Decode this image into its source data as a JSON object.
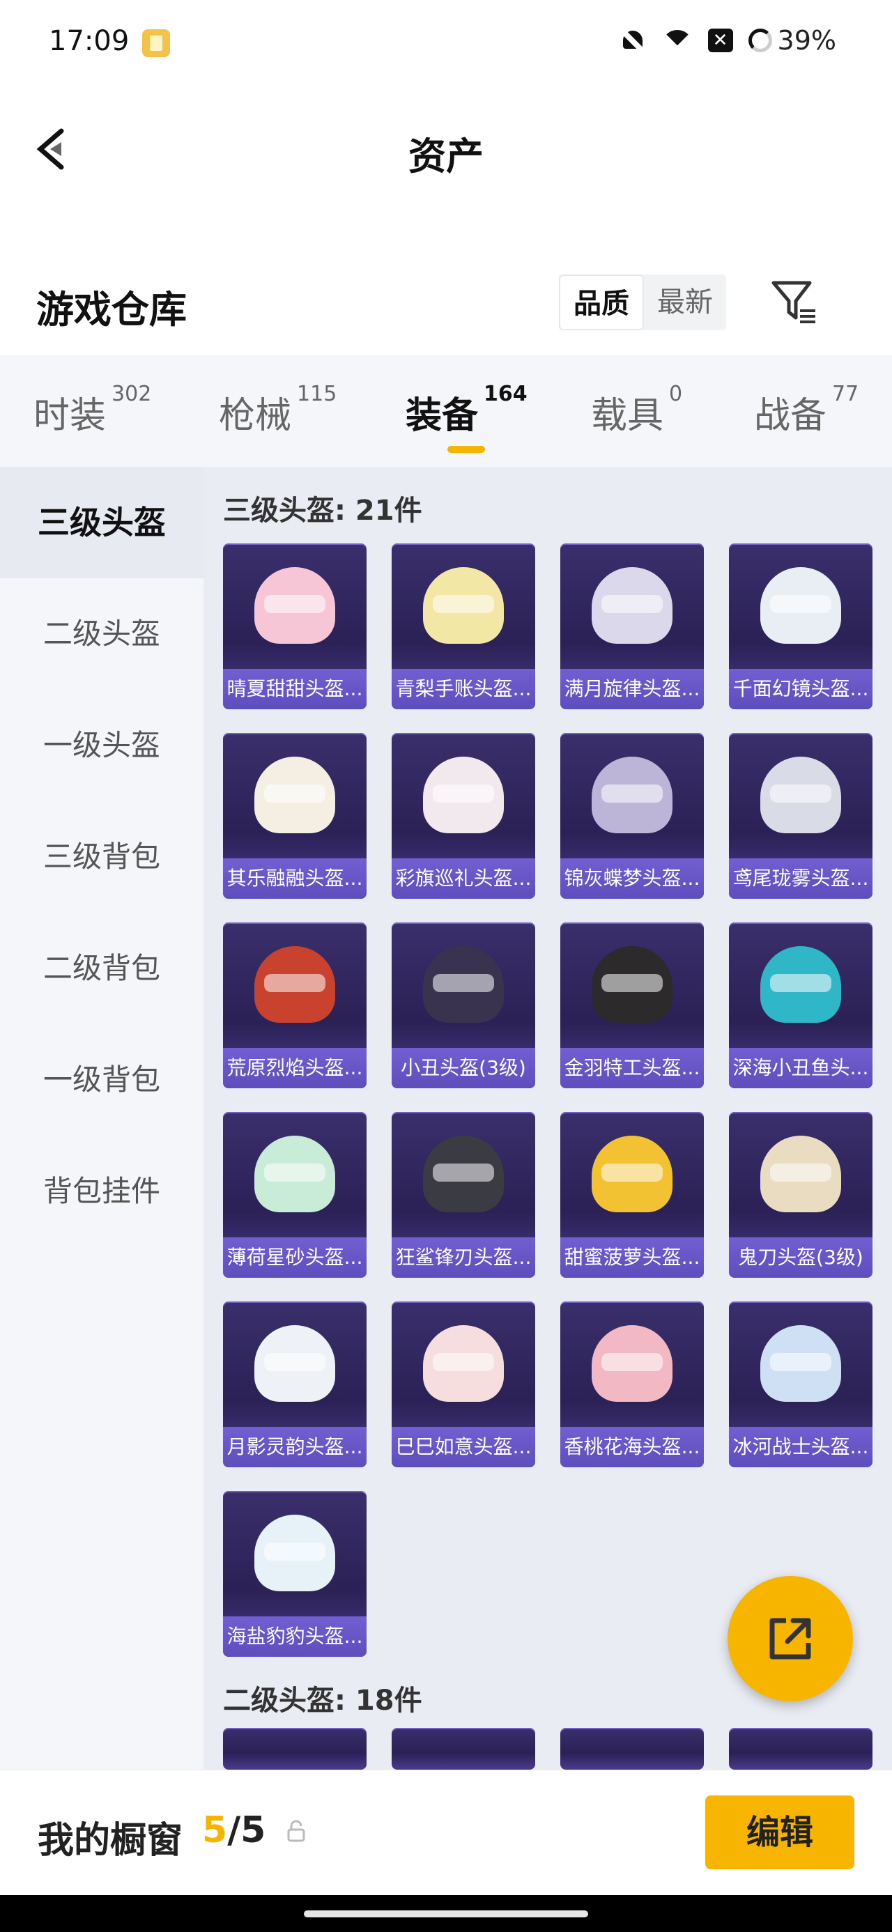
{
  "status_bar": {
    "time": "17:09",
    "battery": "39%",
    "icons": [
      "app-notification-icon",
      "mute-icon",
      "wifi-icon",
      "close-box-icon",
      "battery-icon"
    ]
  },
  "header": {
    "title": "资产"
  },
  "section": {
    "title": "游戏仓库",
    "sort_options": [
      "品质",
      "最新"
    ],
    "sort_selected": "品质"
  },
  "tabs": [
    {
      "label": "时装",
      "count": "302"
    },
    {
      "label": "枪械",
      "count": "115"
    },
    {
      "label": "装备",
      "count": "164",
      "active": true
    },
    {
      "label": "载具",
      "count": "0"
    },
    {
      "label": "战备",
      "count": "77"
    }
  ],
  "sidebar": [
    "三级头盔",
    "二级头盔",
    "一级头盔",
    "三级背包",
    "二级背包",
    "一级背包",
    "背包挂件"
  ],
  "groups": [
    {
      "title": "三级头盔: 21件",
      "items": [
        {
          "name": "晴夏甜甜头盔...",
          "color": "#f6c6d6"
        },
        {
          "name": "青梨手账头盔...",
          "color": "#f3e7a6"
        },
        {
          "name": "满月旋律头盔...",
          "color": "#dcd8ec"
        },
        {
          "name": "千面幻镜头盔...",
          "color": "#e9eef5"
        },
        {
          "name": "其乐融融头盔...",
          "color": "#f4efe2"
        },
        {
          "name": "彩旗巡礼头盔...",
          "color": "#f2e9ef"
        },
        {
          "name": "锦灰蝶梦头盔...",
          "color": "#bdb5d8"
        },
        {
          "name": "鸢尾珑雾头盔...",
          "color": "#d9dbe6"
        },
        {
          "name": "荒原烈焰头盔...",
          "color": "#c8422e"
        },
        {
          "name": "小丑头盔(3级)",
          "color": "#3a3350"
        },
        {
          "name": "金羽特工头盔...",
          "color": "#2c2a2a"
        },
        {
          "name": "深海小丑鱼头...",
          "color": "#2fb7c7"
        },
        {
          "name": "薄荷星砂头盔...",
          "color": "#c9ecd8"
        },
        {
          "name": "狂鲨锋刃头盔...",
          "color": "#3b3b44"
        },
        {
          "name": "甜蜜菠萝头盔...",
          "color": "#f2c232"
        },
        {
          "name": "鬼刀头盔(3级)",
          "color": "#e9dcc0"
        },
        {
          "name": "月影灵韵头盔...",
          "color": "#eef1f6"
        },
        {
          "name": "巳巳如意头盔...",
          "color": "#f6dede"
        },
        {
          "name": "香桃花海头盔...",
          "color": "#f2b8c4"
        },
        {
          "name": "冰河战士头盔...",
          "color": "#cfe0f5"
        },
        {
          "name": "海盐豹豹头盔...",
          "color": "#e6f2f7"
        }
      ]
    },
    {
      "title": "二级头盔: 18件"
    }
  ],
  "bottom_bar": {
    "label": "我的橱窗",
    "current": "5",
    "total": "/5",
    "edit_label": "编辑"
  },
  "accent_color": "#f7b500"
}
